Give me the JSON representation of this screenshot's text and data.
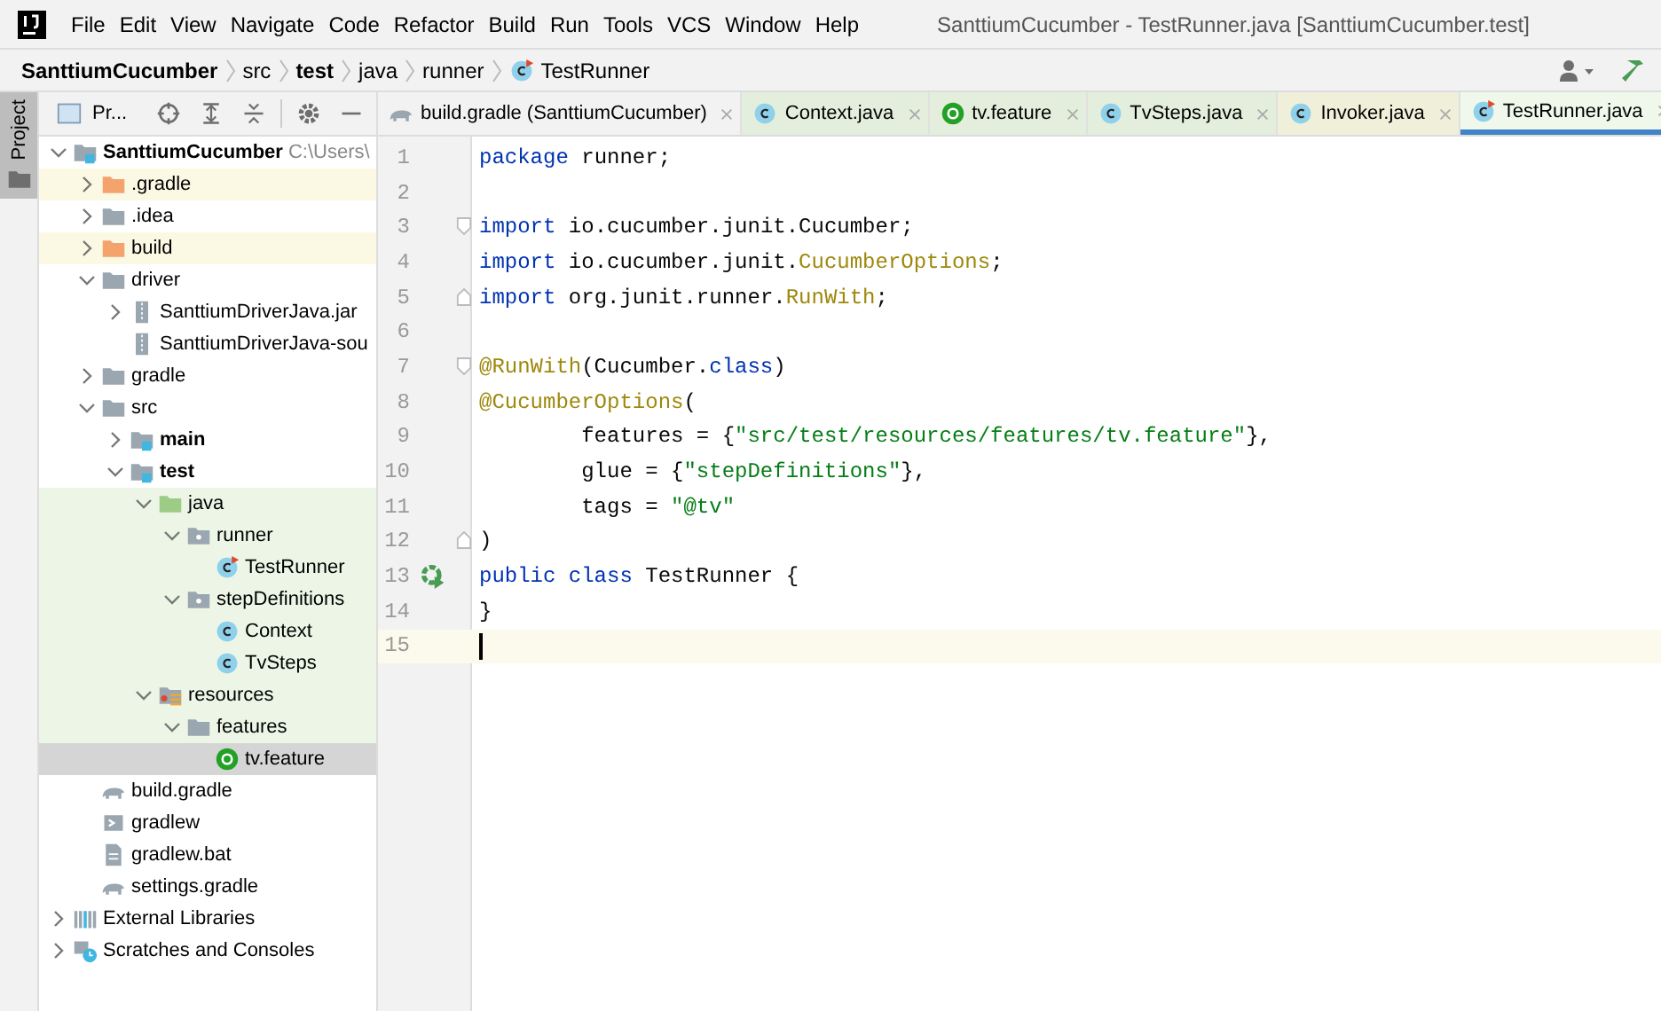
{
  "window": {
    "title": "SanttiumCucumber - TestRunner.java [SanttiumCucumber.test]"
  },
  "menu": [
    "File",
    "Edit",
    "View",
    "Navigate",
    "Code",
    "Refactor",
    "Build",
    "Run",
    "Tools",
    "VCS",
    "Window",
    "Help"
  ],
  "breadcrumbs": [
    {
      "label": "SanttiumCucumber",
      "bold": true,
      "kind": "text"
    },
    {
      "label": "src",
      "bold": false,
      "kind": "text"
    },
    {
      "label": "test",
      "bold": true,
      "kind": "text"
    },
    {
      "label": "java",
      "bold": false,
      "kind": "text"
    },
    {
      "label": "runner",
      "bold": false,
      "kind": "text"
    },
    {
      "label": "TestRunner",
      "bold": false,
      "kind": "class"
    }
  ],
  "side_stripe": {
    "label": "Project"
  },
  "project_panel": {
    "title": "Pr..."
  },
  "tree": [
    {
      "label": "SanttiumCucumber",
      "hint": "C:\\Users\\",
      "kind": "module",
      "bold": true,
      "expanded": true,
      "selected": false,
      "children": [
        {
          "label": ".gradle",
          "kind": "folder-excluded",
          "color": "#fbf9e3",
          "expanded": false,
          "selected": false
        },
        {
          "label": ".idea",
          "kind": "folder",
          "expanded": false,
          "selected": false
        },
        {
          "label": "build",
          "kind": "folder-excluded",
          "color": "#fbf9e3",
          "expanded": false,
          "selected": false
        },
        {
          "label": "driver",
          "kind": "folder",
          "expanded": true,
          "selected": false,
          "children": [
            {
              "label": "SanttiumDriverJava.jar",
              "kind": "jar",
              "expanded": false,
              "selected": false
            },
            {
              "label": "SanttiumDriverJava-sou",
              "kind": "jar",
              "selected": false
            }
          ]
        },
        {
          "label": "gradle",
          "kind": "folder",
          "expanded": false,
          "selected": false
        },
        {
          "label": "src",
          "kind": "folder",
          "expanded": true,
          "selected": false,
          "children": [
            {
              "label": "main",
              "kind": "module",
              "bold": true,
              "expanded": false,
              "selected": false
            },
            {
              "label": "test",
              "kind": "module",
              "bold": true,
              "expanded": true,
              "selected": false,
              "children": [
                {
                  "label": "java",
                  "kind": "folder-test",
                  "color": "#edf6e6",
                  "expanded": true,
                  "selected": false,
                  "children": [
                    {
                      "label": "runner",
                      "kind": "package",
                      "color": "#edf6e6",
                      "expanded": true,
                      "selected": false,
                      "children": [
                        {
                          "label": "TestRunner",
                          "kind": "class-run",
                          "color": "#edf6e6",
                          "selected": false
                        }
                      ]
                    },
                    {
                      "label": "stepDefinitions",
                      "kind": "package",
                      "color": "#edf6e6",
                      "expanded": true,
                      "selected": false,
                      "children": [
                        {
                          "label": "Context",
                          "kind": "class",
                          "color": "#edf6e6",
                          "selected": false
                        },
                        {
                          "label": "TvSteps",
                          "kind": "class",
                          "color": "#edf6e6",
                          "selected": false
                        }
                      ]
                    }
                  ]
                },
                {
                  "label": "resources",
                  "kind": "resources",
                  "color": "#edf6e6",
                  "expanded": true,
                  "selected": false,
                  "children": [
                    {
                      "label": "features",
                      "kind": "folder",
                      "color": "#edf6e6",
                      "expanded": true,
                      "selected": false,
                      "children": [
                        {
                          "label": "tv.feature",
                          "kind": "feature",
                          "selected": true
                        }
                      ]
                    }
                  ]
                }
              ]
            }
          ]
        },
        {
          "label": "build.gradle",
          "kind": "gradle",
          "selected": false
        },
        {
          "label": "gradlew",
          "kind": "script",
          "selected": false
        },
        {
          "label": "gradlew.bat",
          "kind": "file",
          "selected": false
        },
        {
          "label": "settings.gradle",
          "kind": "gradle",
          "selected": false
        }
      ]
    },
    {
      "label": "External Libraries",
      "kind": "libraries",
      "expanded": false,
      "selected": false
    },
    {
      "label": "Scratches and Consoles",
      "kind": "scratches",
      "expanded": false,
      "selected": false
    }
  ],
  "tabs": [
    {
      "label": "build.gradle (SanttiumCucumber)",
      "kind": "gradle",
      "selected": false
    },
    {
      "label": "Context.java",
      "kind": "class",
      "color": "#e3eedc",
      "selected": false
    },
    {
      "label": "tv.feature",
      "kind": "feature",
      "color": "#e3eedc",
      "selected": false
    },
    {
      "label": "TvSteps.java",
      "kind": "class",
      "color": "#e3eedc",
      "selected": false
    },
    {
      "label": "Invoker.java",
      "kind": "class",
      "color": "#efefda",
      "selected": false
    },
    {
      "label": "TestRunner.java",
      "kind": "class-run",
      "color": "#f0f8ec",
      "selected": true
    }
  ],
  "editor": {
    "lines": [
      {
        "number": "1",
        "tokens": [
          {
            "kind": "keyword",
            "text": "package"
          },
          {
            "kind": "plain",
            "text": " runner;"
          }
        ]
      },
      {
        "number": "2"
      },
      {
        "number": "3",
        "fold_start": true,
        "tokens": [
          {
            "kind": "keyword",
            "text": "import"
          },
          {
            "kind": "plain",
            "text": " io.cucumber.junit.Cucumber;"
          }
        ]
      },
      {
        "number": "4",
        "tokens": [
          {
            "kind": "keyword",
            "text": "import"
          },
          {
            "kind": "plain",
            "text": " io.cucumber.junit."
          },
          {
            "kind": "annotation",
            "text": "CucumberOptions"
          },
          {
            "kind": "plain",
            "text": ";"
          }
        ]
      },
      {
        "number": "5",
        "fold_end": true,
        "tokens": [
          {
            "kind": "keyword",
            "text": "import"
          },
          {
            "kind": "plain",
            "text": " org.junit.runner."
          },
          {
            "kind": "annotation",
            "text": "RunWith"
          },
          {
            "kind": "plain",
            "text": ";"
          }
        ]
      },
      {
        "number": "6"
      },
      {
        "number": "7",
        "fold_start": true,
        "tokens": [
          {
            "kind": "annotation",
            "text": "@RunWith"
          },
          {
            "kind": "plain",
            "text": "(Cucumber."
          },
          {
            "kind": "keyword",
            "text": "class"
          },
          {
            "kind": "plain",
            "text": ")"
          }
        ]
      },
      {
        "number": "8",
        "tokens": [
          {
            "kind": "annotation",
            "text": "@CucumberOptions"
          },
          {
            "kind": "plain",
            "text": "("
          }
        ]
      },
      {
        "number": "9",
        "tokens": [
          {
            "kind": "plain",
            "text": "        features = {"
          },
          {
            "kind": "string",
            "text": "\"src/test/resources/features/tv.feature\""
          },
          {
            "kind": "plain",
            "text": "},"
          }
        ]
      },
      {
        "number": "10",
        "tokens": [
          {
            "kind": "plain",
            "text": "        glue = {"
          },
          {
            "kind": "string",
            "text": "\"stepDefinitions\""
          },
          {
            "kind": "plain",
            "text": "},"
          }
        ]
      },
      {
        "number": "11",
        "tokens": [
          {
            "kind": "plain",
            "text": "        tags = "
          },
          {
            "kind": "string",
            "text": "\"@tv\""
          }
        ]
      },
      {
        "number": "12",
        "fold_end": true,
        "tokens": [
          {
            "kind": "plain",
            "text": ")"
          }
        ]
      },
      {
        "number": "13",
        "run": true,
        "tokens": [
          {
            "kind": "keyword",
            "text": "public class"
          },
          {
            "kind": "plain",
            "text": " TestRunner {"
          }
        ]
      },
      {
        "number": "14",
        "tokens": [
          {
            "kind": "plain",
            "text": "}"
          }
        ]
      },
      {
        "number": "15",
        "current": true
      }
    ]
  }
}
